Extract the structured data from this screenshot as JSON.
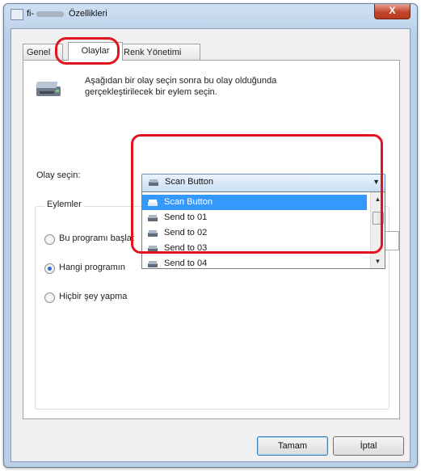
{
  "window": {
    "title_prefix": "fi-",
    "title": "Özellikleri",
    "close_label": "X"
  },
  "tabs": [
    {
      "label": "Genel"
    },
    {
      "label": "Olaylar"
    },
    {
      "label": "Renk Yönetimi"
    }
  ],
  "description": "Aşağıdan bir olay seçin sonra bu olay olduğunda gerçekleştirilecek bir eylem seçin.",
  "event_select": {
    "label": "Olay seçin:",
    "selected": "Scan Button",
    "options": [
      "Scan Button",
      "Send to 01",
      "Send to 02",
      "Send to 03",
      "Send to 04"
    ]
  },
  "actions": {
    "group_title": "Eylemler",
    "radios": [
      {
        "label": "Bu programı başlat",
        "checked": false
      },
      {
        "label": "Hangi programın",
        "checked": true
      },
      {
        "label": "Hiçbir şey yapma",
        "checked": false
      }
    ]
  },
  "buttons": {
    "ok": "Tamam",
    "cancel": "İptal"
  },
  "colors": {
    "highlight": "#e0141e",
    "selection": "#3399ff"
  }
}
